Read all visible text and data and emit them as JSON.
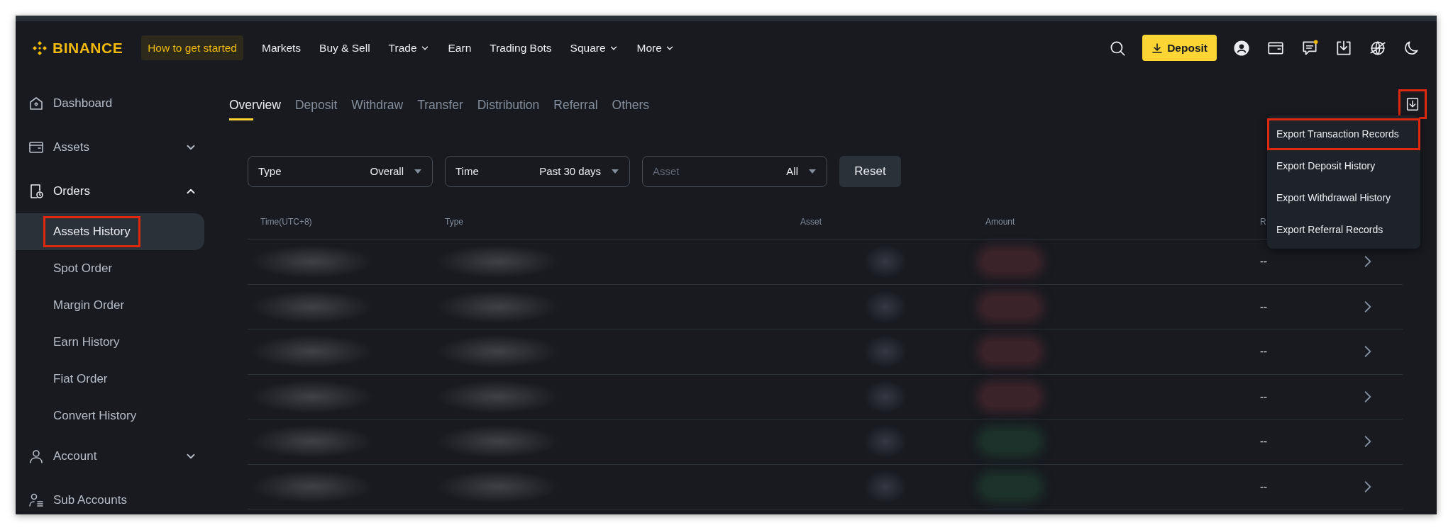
{
  "nav": {
    "logo": "BINANCE",
    "items": [
      {
        "label": "How to get started",
        "kind": "pill",
        "has_caret": false
      },
      {
        "label": "Markets",
        "kind": "link",
        "has_caret": false
      },
      {
        "label": "Buy & Sell",
        "kind": "link",
        "has_caret": false
      },
      {
        "label": "Trade",
        "kind": "link",
        "has_caret": true
      },
      {
        "label": "Earn",
        "kind": "link",
        "has_caret": false
      },
      {
        "label": "Trading Bots",
        "kind": "link",
        "has_caret": false
      },
      {
        "label": "Square",
        "kind": "link",
        "has_caret": true
      },
      {
        "label": "More",
        "kind": "link",
        "has_caret": true
      }
    ],
    "deposit_button": "Deposit",
    "messages_badge": true
  },
  "sidebar": {
    "items": [
      {
        "label": "Dashboard",
        "expandable": false,
        "expanded": false
      },
      {
        "label": "Assets",
        "expandable": true,
        "expanded": false
      },
      {
        "label": "Orders",
        "expandable": true,
        "expanded": true,
        "children": [
          {
            "label": "Assets History",
            "selected": true,
            "highlighted": true
          },
          {
            "label": "Spot Order",
            "selected": false,
            "highlighted": false
          },
          {
            "label": "Margin Order",
            "selected": false,
            "highlighted": false
          },
          {
            "label": "Earn History",
            "selected": false,
            "highlighted": false
          },
          {
            "label": "Fiat Order",
            "selected": false,
            "highlighted": false
          },
          {
            "label": "Convert History",
            "selected": false,
            "highlighted": false
          }
        ]
      },
      {
        "label": "Account",
        "expandable": true,
        "expanded": false
      },
      {
        "label": "Sub Accounts",
        "expandable": false,
        "expanded": false
      }
    ]
  },
  "tabs": [
    {
      "label": "Overview",
      "selected": true
    },
    {
      "label": "Deposit",
      "selected": false
    },
    {
      "label": "Withdraw",
      "selected": false
    },
    {
      "label": "Transfer",
      "selected": false
    },
    {
      "label": "Distribution",
      "selected": false
    },
    {
      "label": "Referral",
      "selected": false
    },
    {
      "label": "Others",
      "selected": false
    }
  ],
  "export_button": {
    "highlighted": true
  },
  "filters": [
    {
      "label": "Type",
      "value": "Overall",
      "label_dimmed": false
    },
    {
      "label": "Time",
      "value": "Past 30 days",
      "label_dimmed": false
    },
    {
      "label": "Asset",
      "value": "All",
      "label_dimmed": true
    }
  ],
  "reset_button": "Reset",
  "table": {
    "columns": [
      "Time(UTC+8)",
      "Type",
      "Asset",
      "Amount",
      "R"
    ],
    "rows": [
      {
        "column_5": "--",
        "color": "#3a2329"
      },
      {
        "column_5": "--",
        "color": "#3a2329"
      },
      {
        "column_5": "--",
        "color": "#3a2329"
      },
      {
        "column_5": "--",
        "color": "#3a2329"
      },
      {
        "column_5": "--",
        "color": "#1c3129"
      },
      {
        "column_5": "--",
        "color": "#1c3129"
      }
    ]
  },
  "export_menu": {
    "items": [
      {
        "label": "Export Transaction Records",
        "highlighted": true
      },
      {
        "label": "Export Deposit History",
        "highlighted": false
      },
      {
        "label": "Export Withdrawal History",
        "highlighted": false
      },
      {
        "label": "Export Referral Records",
        "highlighted": false
      }
    ]
  }
}
